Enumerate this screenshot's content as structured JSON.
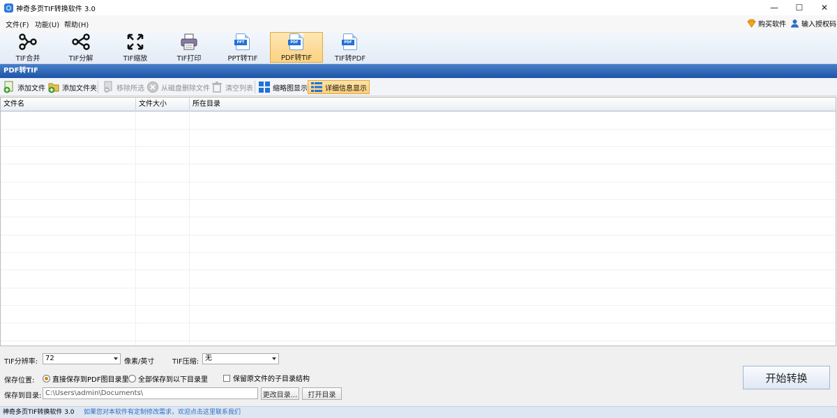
{
  "window": {
    "title": "神奇多页TIF转换软件 3.0",
    "controls": {
      "minimize": "—",
      "maximize": "☐",
      "close": "✕"
    }
  },
  "menu": {
    "items": [
      "文件(F)",
      "功能(U)",
      "帮助(H)"
    ],
    "buy_label": "购买软件",
    "license_label": "输入授权码"
  },
  "toolbar": {
    "tools": [
      {
        "label": "TIF合并",
        "icon": "merge-icon"
      },
      {
        "label": "TIF分解",
        "icon": "split-icon"
      },
      {
        "label": "TIF缩放",
        "icon": "resize-icon"
      },
      {
        "label": "TIF打印",
        "icon": "printer-icon"
      },
      {
        "label": "PPT转TIF",
        "icon": "ppt-file-icon",
        "badge": "PPT"
      },
      {
        "label": "PDF转TIF",
        "icon": "pdf-file-icon",
        "badge": "PDF"
      },
      {
        "label": "TIF转PDF",
        "icon": "pdf-file-icon",
        "badge": "PDF"
      }
    ],
    "active": "PDF转TIF"
  },
  "section": {
    "title": "PDF转TIF"
  },
  "subtoolbar": {
    "add_file": "添加文件",
    "add_folder": "添加文件夹",
    "remove_selected": "移除所选",
    "delete_from_disk": "从磁盘删除文件",
    "clear_list": "清空列表",
    "thumbnail_view": "缩略图显示",
    "detail_view": "详细信息显示"
  },
  "table": {
    "columns": [
      "文件名",
      "文件大小",
      "所在目录"
    ],
    "rows": []
  },
  "settings": {
    "dpi_label": "TIF分辨率:",
    "dpi_value": "72",
    "dpi_unit": "像素/英寸",
    "compression_label": "TIF压缩:",
    "compression_value": "无",
    "save_location_label": "保存位置:",
    "option_same_dir": "直接保存到PDF图目录里",
    "option_custom_dir": "全部保存到以下目录里",
    "option_selected": "直接保存到PDF图目录里",
    "keep_structure": "保留原文件的子目录结构",
    "keep_structure_checked": false,
    "save_dir_label": "保存到目录:",
    "save_dir_value": "C:\\Users\\admin\\Documents\\",
    "change_dir_button": "更改目录...",
    "open_dir_button": "打开目录",
    "start_button": "开始转换"
  },
  "status": {
    "app_name": "神奇多页TIF转换软件 3.0",
    "message": "如果您对本软件有定制修改需求，欢迎点击这里联系我们"
  },
  "colors": {
    "accent_blue": "#1d55a8",
    "active_orange": "#fbcf78",
    "link_blue": "#2e6fc2"
  }
}
